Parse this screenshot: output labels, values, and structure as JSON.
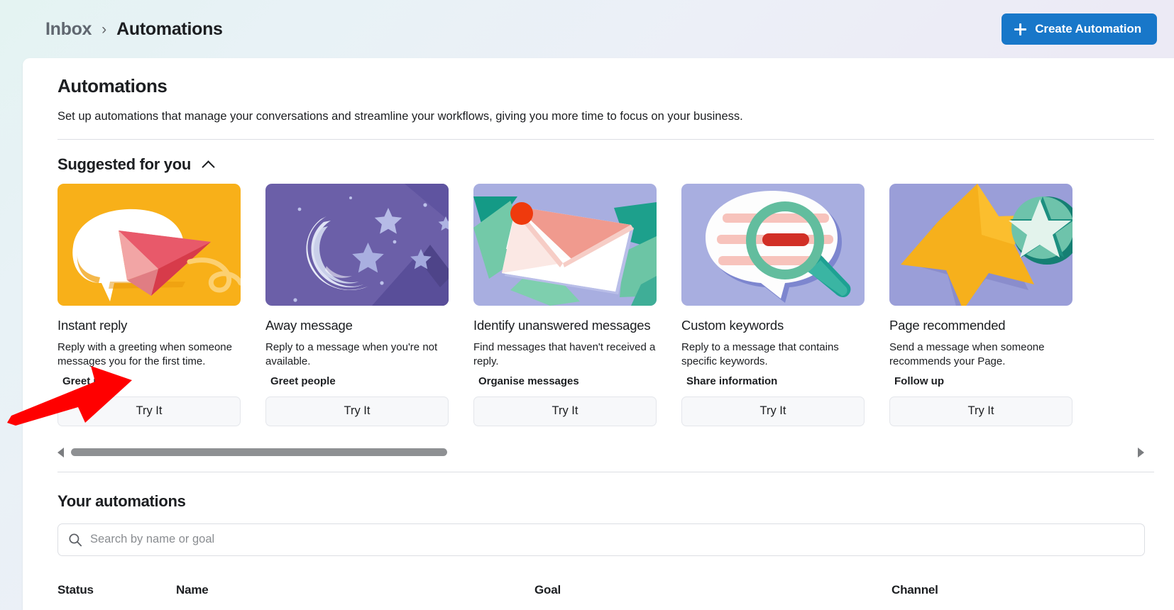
{
  "breadcrumb": {
    "parent": "Inbox",
    "separator": "›",
    "current": "Automations"
  },
  "header": {
    "create_button_label": "Create Automation",
    "create_button_icon": "plus-icon",
    "create_button_color": "#1877c9"
  },
  "page": {
    "title": "Automations",
    "description": "Set up automations that manage your conversations and streamline your workflows, giving you more time to focus on your business."
  },
  "suggested": {
    "section_title": "Suggested for you",
    "collapse_icon": "chevron-up-icon",
    "cards": [
      {
        "title": "Instant reply",
        "description": "Reply with a greeting when someone messages you for the first time.",
        "tag": "Greet people",
        "button_label": "Try It",
        "image": "paper-plane-chat-bubble-illustration",
        "image_bg": "#f8b019"
      },
      {
        "title": "Away message",
        "description": "Reply to a message when you're not available.",
        "tag": "Greet people",
        "button_label": "Try It",
        "image": "crescent-moon-stars-night-illustration",
        "image_bg": "#6b5fa8"
      },
      {
        "title": "Identify unanswered messages",
        "description": "Find messages that haven't received a reply.",
        "tag": "Organise messages",
        "button_label": "Try It",
        "image": "envelope-unread-dot-illustration",
        "image_bg": "#a8aee0"
      },
      {
        "title": "Custom keywords",
        "description": "Reply to a message that contains specific keywords.",
        "tag": "Share information",
        "button_label": "Try It",
        "image": "magnifier-chat-bubble-illustration",
        "image_bg": "#a8aee0"
      },
      {
        "title": "Page recommended",
        "description": "Send a message when someone recommends your Page.",
        "tag": "Follow up",
        "button_label": "Try It",
        "image": "star-badge-illustration",
        "image_bg": "#9a9ed8"
      }
    ],
    "scroll_left_icon": "triangle-left-icon",
    "scroll_right_icon": "triangle-right-icon",
    "scroll_thumb_percent": 36
  },
  "your_automations": {
    "title": "Your automations",
    "search": {
      "icon": "search-icon",
      "placeholder": "Search by name or goal",
      "value": ""
    },
    "table_headers": [
      "Status",
      "Name",
      "Goal",
      "Channel"
    ]
  },
  "annotation": {
    "arrow": "red-pointer-arrow",
    "arrow_color": "#ff0000",
    "points_at": "Try It"
  }
}
